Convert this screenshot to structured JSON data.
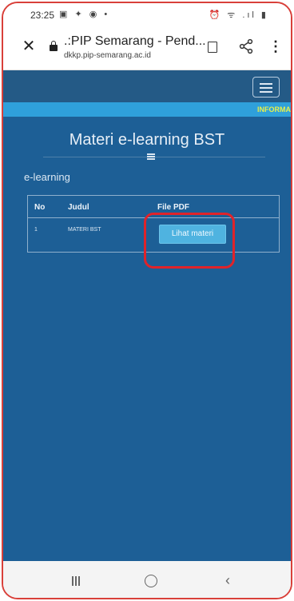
{
  "status_bar": {
    "time": "23:25",
    "left_icons": "▣ ✦ ◉ •",
    "right_icons": "⏰ ᯤ .ıl ▮"
  },
  "browser": {
    "page_title": ".:PIP Semarang - Pend...",
    "url": "dkkp.pip-semarang.ac.id",
    "close_symbol": "✕",
    "menu_symbol": "⋮"
  },
  "site": {
    "ticker": "INFORMA"
  },
  "main": {
    "title": "Materi e-learning BST",
    "section_label": "e-learning",
    "table": {
      "headers": [
        "No",
        "Judul",
        "File PDF"
      ],
      "rows": [
        {
          "no": "1",
          "judul": "MATERI BST",
          "button_label": "Lihat materi"
        }
      ]
    }
  },
  "nav_bar": {
    "back_symbol": "‹"
  },
  "colors": {
    "page_bg": "#1d5f96",
    "header_bg": "#245a86",
    "ticker_bg": "#2fa0db",
    "ticker_text": "#e8f04a",
    "button_bg": "#4fb3e0",
    "highlight": "#e0232a",
    "frame": "#d9403a"
  },
  "icons": {
    "browser": [
      "close-icon",
      "lock-icon",
      "bookmark-icon",
      "share-icon",
      "more-vert-icon"
    ],
    "page": [
      "hamburger-menu-icon",
      "list-icon"
    ],
    "nav": [
      "recents-icon",
      "home-icon",
      "back-icon"
    ]
  }
}
